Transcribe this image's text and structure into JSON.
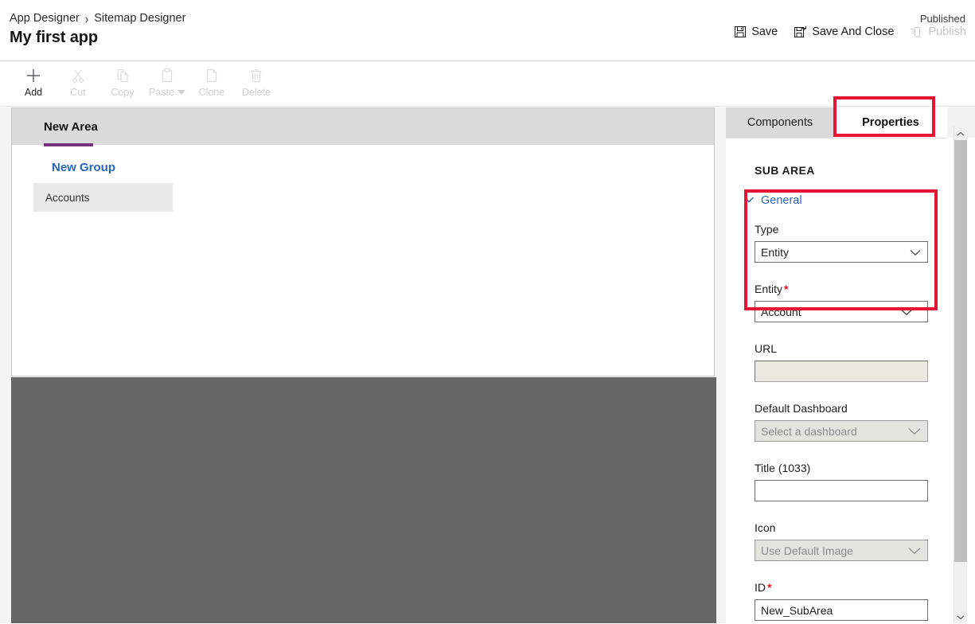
{
  "header": {
    "breadcrumb": [
      "App Designer",
      "Sitemap Designer"
    ],
    "breadcrumb_separator": "›",
    "app_title": "My first app",
    "published_status": "Published",
    "actions": [
      {
        "label": "Save",
        "icon": "save-icon",
        "enabled": true
      },
      {
        "label": "Save And Close",
        "icon": "save-and-close-icon",
        "enabled": true
      },
      {
        "label": "Publish",
        "icon": "publish-icon",
        "enabled": false
      }
    ]
  },
  "toolbar": {
    "items": [
      {
        "label": "Add",
        "icon": "plus-icon",
        "enabled": true,
        "has_caret": false
      },
      {
        "label": "Cut",
        "icon": "scissors-icon",
        "enabled": false,
        "has_caret": false
      },
      {
        "label": "Copy",
        "icon": "copy-icon",
        "enabled": false,
        "has_caret": false
      },
      {
        "label": "Paste",
        "icon": "clipboard-icon",
        "enabled": false,
        "has_caret": true
      },
      {
        "label": "Clone",
        "icon": "clone-icon",
        "enabled": false,
        "has_caret": false
      },
      {
        "label": "Delete",
        "icon": "trash-icon",
        "enabled": false,
        "has_caret": false
      }
    ]
  },
  "canvas": {
    "area_tab": "New Area",
    "group_title": "New Group",
    "subarea": "Accounts",
    "accent_color": "#76317c",
    "group_link_color": "#2666bd",
    "dim_overlay_color": "#666666"
  },
  "panel": {
    "tabs": [
      {
        "label": "Components",
        "active": false
      },
      {
        "label": "Properties",
        "active": true
      }
    ],
    "section_heading": "SUB AREA",
    "general_label": "General",
    "general_expanded": true,
    "fields": [
      {
        "label": "Type",
        "required": false,
        "control": "dropdown",
        "value": "Entity",
        "placeholder": "",
        "enabled": true
      },
      {
        "label": "Entity",
        "required": true,
        "control": "dropdown",
        "value": "Account",
        "placeholder": "",
        "enabled": true
      },
      {
        "label": "URL",
        "required": false,
        "control": "input",
        "value": "",
        "placeholder": "",
        "enabled": false
      },
      {
        "label": "Default Dashboard",
        "required": false,
        "control": "dropdown",
        "value": "",
        "placeholder": "Select a dashboard",
        "enabled": false
      },
      {
        "label": "Title (1033)",
        "required": false,
        "control": "input",
        "value": "",
        "placeholder": "",
        "enabled": true
      },
      {
        "label": "Icon",
        "required": false,
        "control": "dropdown",
        "value": "Use Default Image",
        "placeholder": "",
        "enabled": false
      },
      {
        "label": "ID",
        "required": true,
        "control": "input",
        "value": "New_SubArea",
        "placeholder": "",
        "enabled": true
      }
    ]
  },
  "annotations": {
    "color": "#e81434",
    "boxes": [
      "properties-tab",
      "type-and-entity-fields"
    ]
  },
  "scrollbar": {
    "up_arrow": "chevron-up-icon",
    "down_arrow": "chevron-down-icon"
  }
}
